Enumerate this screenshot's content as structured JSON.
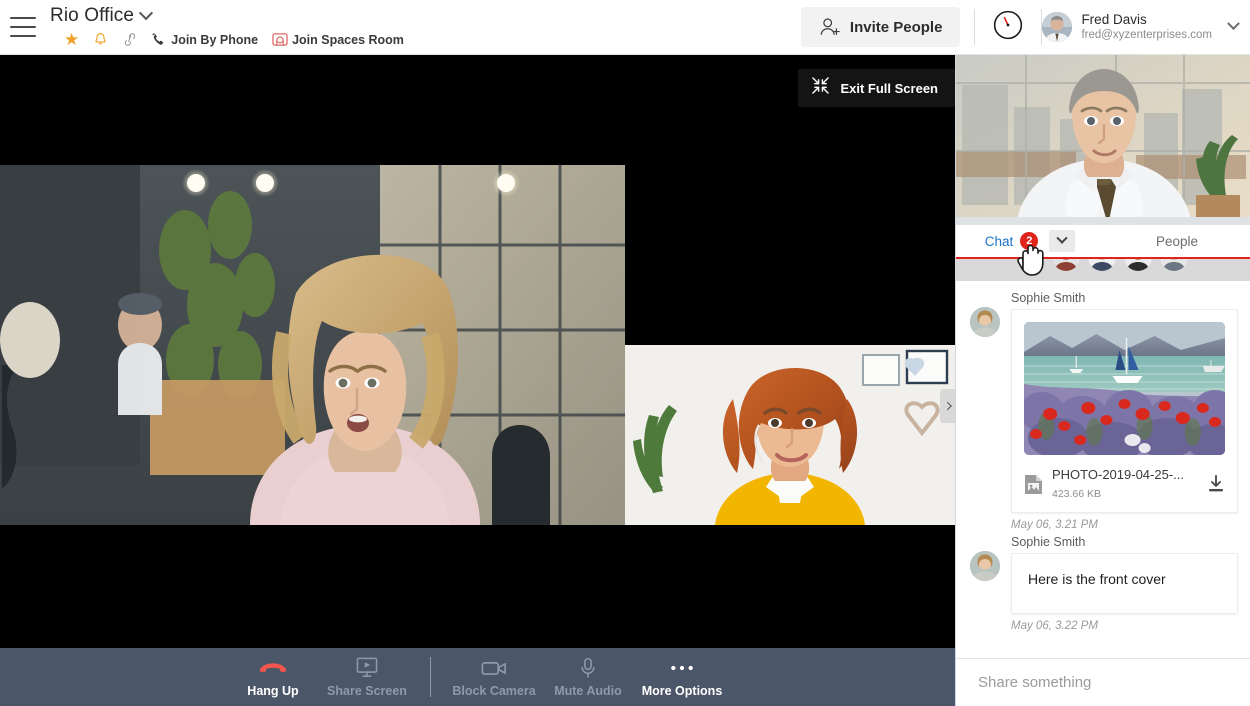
{
  "header": {
    "menu_icon": "hamburger-menu-icon",
    "space_title": "Rio Office",
    "title_chevron": "chevron-down-icon",
    "favorite_icon": "star-icon",
    "notification_icon": "bell-icon",
    "link_icon": "link-icon",
    "join_by_phone_icon": "phone-icon",
    "join_by_phone": "Join By Phone",
    "join_spaces_icon": "spaces-room-icon",
    "join_spaces_room": "Join Spaces Room",
    "invite_icon": "add-person-icon",
    "invite_label": "Invite People",
    "timer_icon": "clock-timer-icon",
    "user_name": "Fred Davis",
    "user_email": "fred@xyzenterprises.com",
    "user_chevron": "chevron-down-icon",
    "avatar": "user-avatar"
  },
  "stage": {
    "exit_fullscreen_icon": "collapse-arrows-icon",
    "exit_fullscreen_label": "Exit Full Screen",
    "collapse_handle_icon": "chevron-right-icon",
    "main_video_alt": "active-speaker-video",
    "second_video_alt": "participant-video"
  },
  "controls": [
    {
      "name": "hang-up",
      "icon": "phone-hangup-icon",
      "label": "Hang Up",
      "state": "hangup"
    },
    {
      "name": "share-screen",
      "icon": "screen-share-icon",
      "label": "Share Screen",
      "state": "dim"
    },
    {
      "name": "block-camera",
      "icon": "camera-icon",
      "label": "Block Camera",
      "state": "dim"
    },
    {
      "name": "mute-audio",
      "icon": "microphone-icon",
      "label": "Mute Audio",
      "state": "dim"
    },
    {
      "name": "more-options",
      "icon": "ellipsis-icon",
      "label": "More Options",
      "state": "on"
    }
  ],
  "panel": {
    "selfview_alt": "self-view-video",
    "tab_chat": "Chat",
    "chat_badge": "2",
    "tab_chat_dropdown_icon": "chevron-down-icon",
    "tab_people": "People",
    "active_tab": "Chat",
    "cursor_icon": "pointer-hand-cursor",
    "messages": [
      {
        "sender": "Sophie Smith",
        "type": "attachment",
        "file_icon": "image-file-icon",
        "file_name": "PHOTO-2019-04-25-...",
        "file_size": "423.66 KB",
        "download_icon": "download-icon",
        "image_alt": "lavender-field-sailboats-photo",
        "timestamp": "May 06, 3.21 PM"
      },
      {
        "sender": "Sophie Smith",
        "type": "text",
        "text": "Here is the front cover",
        "timestamp": "May 06, 3.22 PM"
      }
    ],
    "composer_placeholder": "Share something"
  },
  "colors": {
    "accent_red": "#e0231b",
    "accent_orange": "#f0a029",
    "link_blue": "#1a73c8",
    "controlbar": "#4b5769"
  }
}
